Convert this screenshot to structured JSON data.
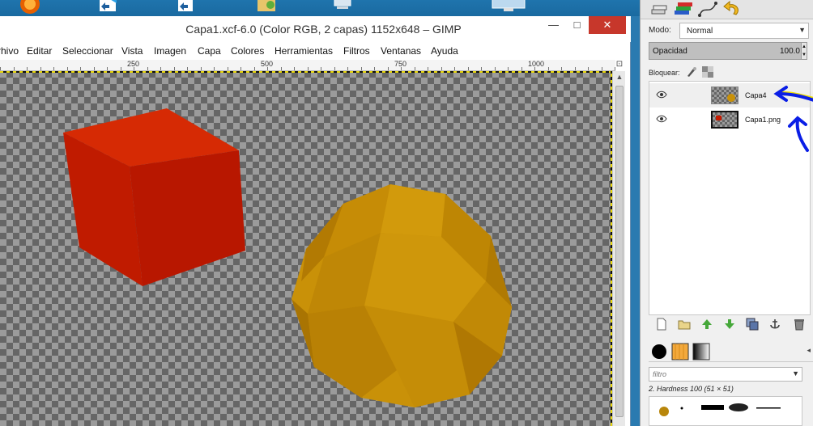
{
  "window": {
    "title": "Capa1.xcf-6.0 (Color RGB, 2 capas) 1152x648 – GIMP",
    "close_label": "✕",
    "minimize_label": "—",
    "maximize_label": "□"
  },
  "menubar": {
    "items": [
      "rhivo",
      "Editar",
      "Seleccionar",
      "Vista",
      "Imagen",
      "Capa",
      "Colores",
      "Herramientas",
      "Filtros",
      "Ventanas",
      "Ayuda"
    ]
  },
  "ruler": {
    "labels": [
      "250",
      "500",
      "750",
      "1000"
    ]
  },
  "canvas": {
    "cube_color": "#c41a00",
    "sphere_color": "#c98f05"
  },
  "dock": {
    "mode_label": "Modo:",
    "mode_value": "Normal",
    "opacity_label": "Opacidad",
    "opacity_value": "100.0",
    "opacity_percent": 100,
    "lock_label": "Bloquear:",
    "layers": [
      {
        "name": "Capa4",
        "visible": true,
        "selected": true
      },
      {
        "name": "Capa1.png",
        "visible": true,
        "selected": false
      }
    ],
    "filter_placeholder": "filtro",
    "brush_name": "2. Hardness 100 (51 × 51)"
  },
  "colors": {
    "annotation_arrow": "#0a1ee6",
    "annotation_highlight": "#f0e000",
    "close_button": "#c7372b"
  }
}
